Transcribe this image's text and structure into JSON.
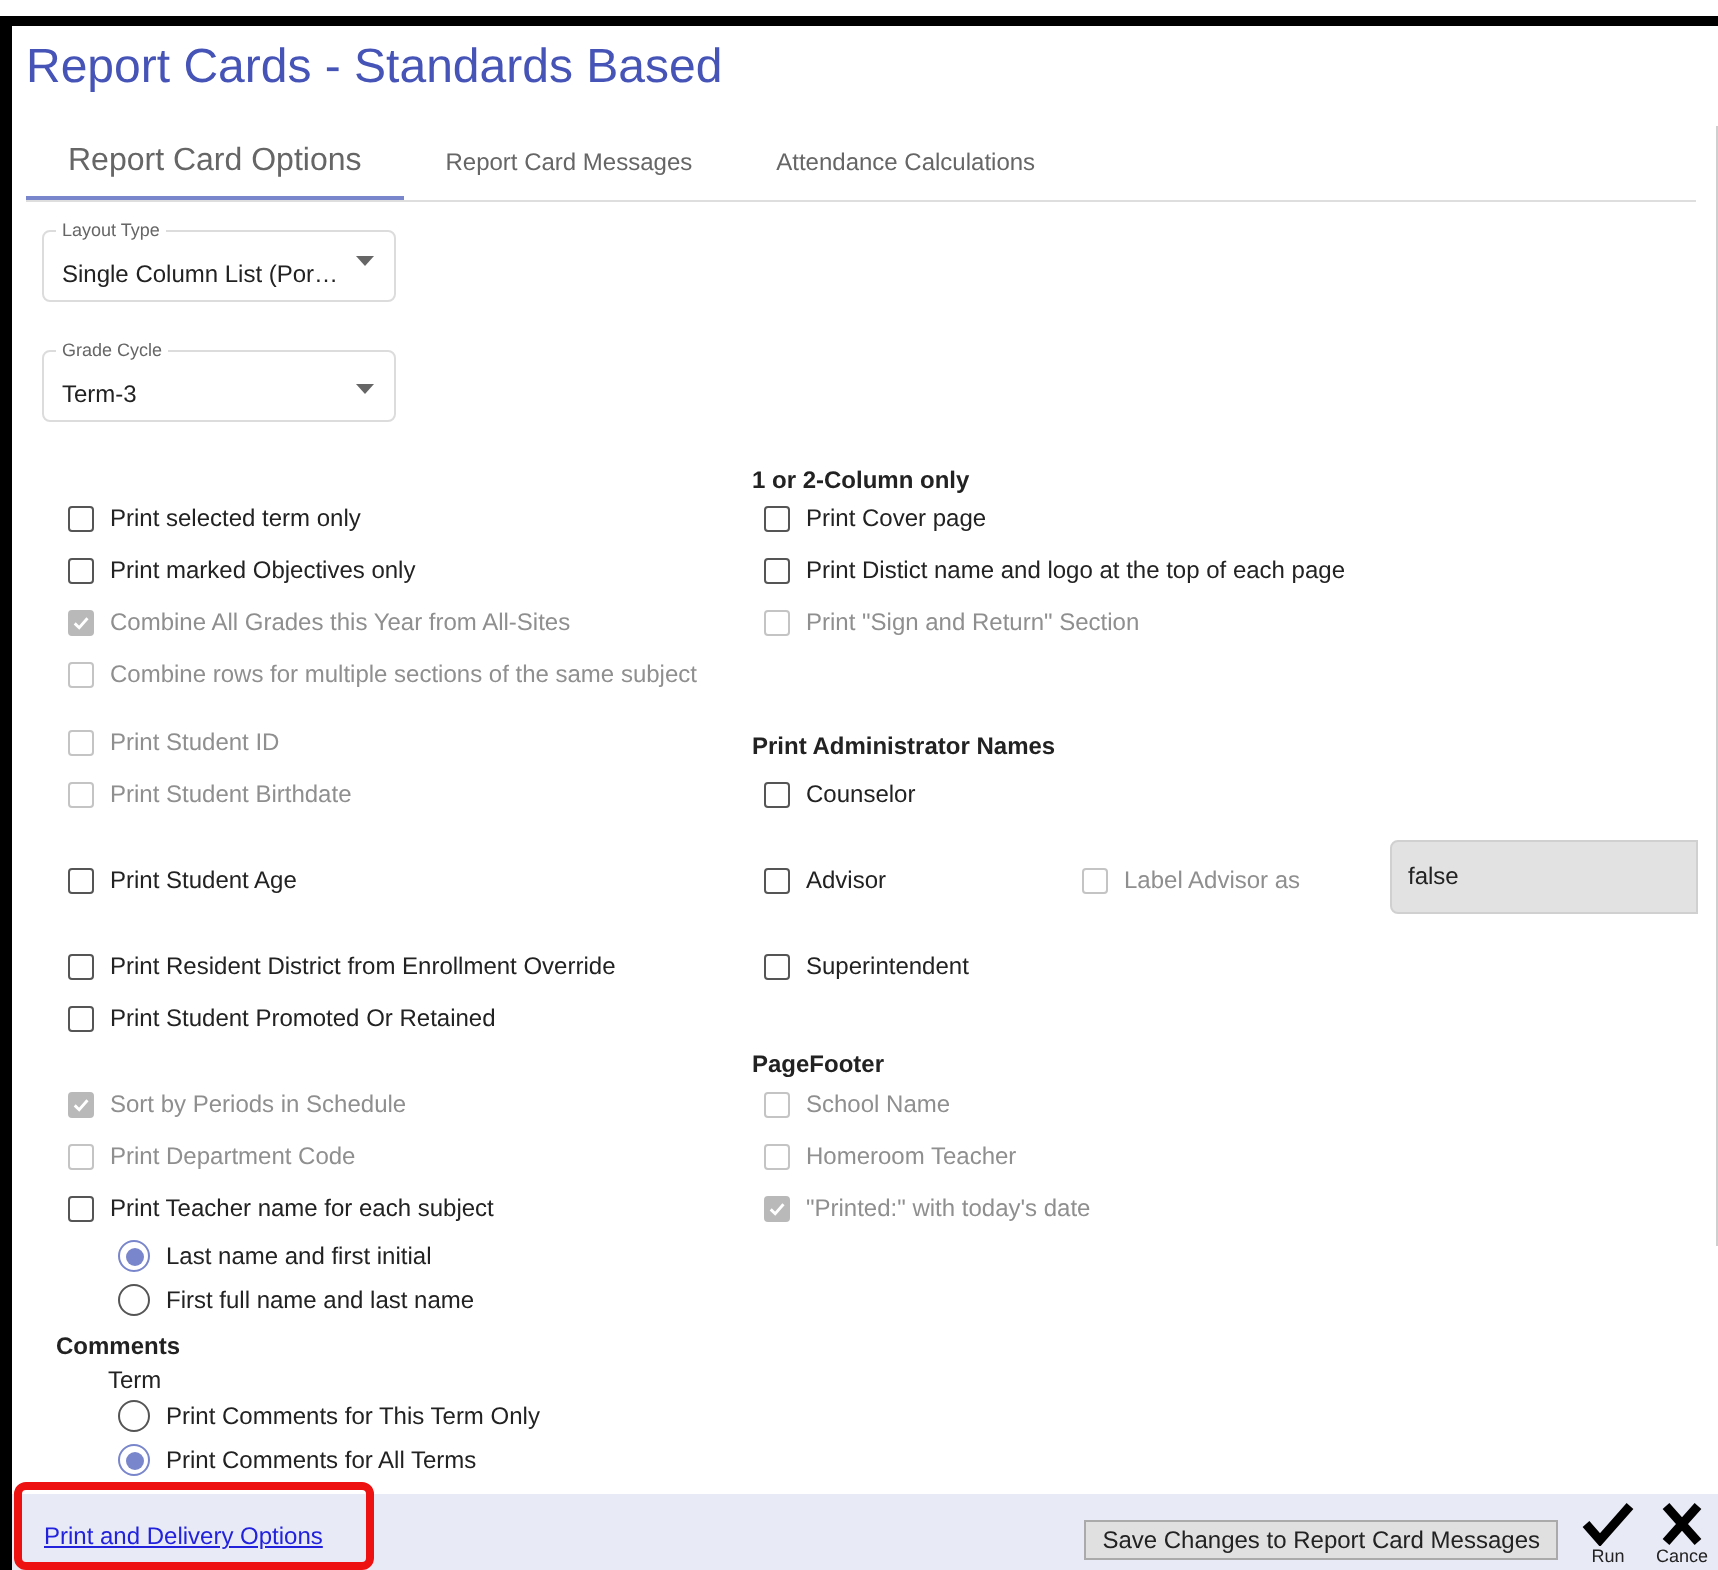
{
  "title": "Report Cards - Standards Based",
  "tabs": [
    {
      "label": "Report Card Options",
      "selected": true
    },
    {
      "label": "Report Card Messages",
      "selected": false
    },
    {
      "label": "Attendance Calculations",
      "selected": false
    }
  ],
  "selects": [
    {
      "label": "Layout Type",
      "value": "Single Column List (Por…"
    },
    {
      "label": "Grade Cycle",
      "value": "Term-3"
    }
  ],
  "left_column": [
    {
      "kind": "checkbox",
      "label": "Print selected term only",
      "checked": false,
      "disabled": false
    },
    {
      "kind": "checkbox",
      "label": "Print marked Objectives only",
      "checked": false,
      "disabled": false
    },
    {
      "kind": "checkbox",
      "label": "Combine All Grades this Year from All-Sites",
      "checked": true,
      "disabled": true
    },
    {
      "kind": "checkbox",
      "label": "Combine rows for multiple sections of the same subject",
      "checked": false,
      "disabled": true
    },
    {
      "kind": "checkbox",
      "label": "Print Student ID",
      "checked": false,
      "disabled": true
    },
    {
      "kind": "checkbox",
      "label": "Print Student Birthdate",
      "checked": false,
      "disabled": true
    },
    {
      "kind": "checkbox",
      "label": "Print Student Age",
      "checked": false,
      "disabled": false
    },
    {
      "kind": "checkbox",
      "label": "Print Resident District from Enrollment Override",
      "checked": false,
      "disabled": false
    },
    {
      "kind": "checkbox",
      "label": "Print Student Promoted Or Retained",
      "checked": false,
      "disabled": false
    },
    {
      "kind": "checkbox",
      "label": "Sort by Periods in Schedule",
      "checked": true,
      "disabled": true
    },
    {
      "kind": "checkbox",
      "label": "Print Department Code",
      "checked": false,
      "disabled": true
    },
    {
      "kind": "checkbox",
      "label": "Print Teacher name for each subject",
      "checked": false,
      "disabled": false
    },
    {
      "kind": "radio",
      "label": "Last name and first initial",
      "selected": true
    },
    {
      "kind": "radio",
      "label": "First full name and last name",
      "selected": false
    },
    {
      "kind": "heading",
      "label": "Comments"
    },
    {
      "kind": "subheading",
      "label": "Term"
    },
    {
      "kind": "radio",
      "label": "Print Comments for This Term Only",
      "selected": false
    },
    {
      "kind": "radio",
      "label": "Print Comments for All Terms",
      "selected": true
    }
  ],
  "right_column": [
    {
      "kind": "heading",
      "label": "1 or 2-Column only"
    },
    {
      "kind": "checkbox",
      "label": "Print Cover page",
      "checked": false,
      "disabled": false
    },
    {
      "kind": "checkbox",
      "label": "Print Distict name and logo at the top of each page",
      "checked": false,
      "disabled": false
    },
    {
      "kind": "checkbox",
      "label": "Print \"Sign and Return\" Section",
      "checked": false,
      "disabled": true
    },
    {
      "kind": "heading",
      "label": "Print Administrator Names"
    },
    {
      "kind": "checkbox",
      "label": "Counselor",
      "checked": false,
      "disabled": false
    },
    {
      "kind": "advisor",
      "label": "Advisor",
      "checked": false,
      "disabled": false,
      "option_label": "Label Advisor as",
      "option_checked": false,
      "option_disabled": true,
      "field_value": "false"
    },
    {
      "kind": "checkbox",
      "label": "Superintendent",
      "checked": false,
      "disabled": false
    },
    {
      "kind": "heading",
      "label": "PageFooter"
    },
    {
      "kind": "checkbox",
      "label": "School Name",
      "checked": false,
      "disabled": true
    },
    {
      "kind": "checkbox",
      "label": "Homeroom Teacher",
      "checked": false,
      "disabled": true
    },
    {
      "kind": "checkbox",
      "label": "\"Printed:\" with today's date",
      "checked": true,
      "disabled": true
    }
  ],
  "footer": {
    "link": "Print and Delivery Options",
    "save_button": "Save Changes to Report Card Messages",
    "run_label": "Run",
    "cancel_label": "Cance"
  }
}
